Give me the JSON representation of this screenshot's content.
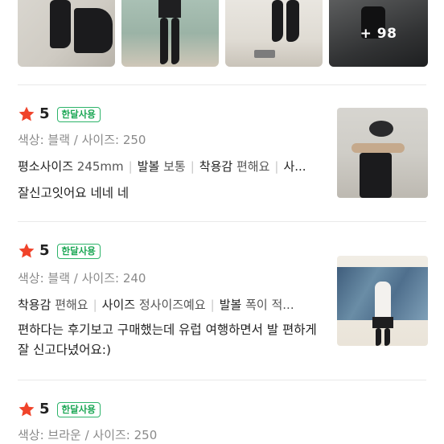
{
  "gallery": {
    "more_count": "+ 98"
  },
  "reviews": [
    {
      "rating": "5",
      "badge": "한달사용",
      "options": "색상: 블랙 / 사이즈: 250",
      "details": [
        {
          "key": "평소사이즈",
          "value": "245mm"
        },
        {
          "key": "발볼",
          "value": "보통"
        },
        {
          "key": "착용감",
          "value": "편해요"
        },
        {
          "key": "사...",
          "value": ""
        }
      ],
      "text": "잘신고잇어요 네네 네"
    },
    {
      "rating": "5",
      "badge": "한달사용",
      "options": "색상: 블랙 / 사이즈: 240",
      "details": [
        {
          "key": "착용감",
          "value": "편해요"
        },
        {
          "key": "사이즈",
          "value": "정사이즈예요"
        },
        {
          "key": "발볼",
          "value": "폭이 적..."
        }
      ],
      "text": "편하다는 후기보고 구매했는데 유럽 여행하면서 발 편하게 잘 신고다녔어요:)"
    },
    {
      "rating": "5",
      "badge": "한달사용",
      "options": "색상: 브라운 / 사이즈: 250"
    }
  ],
  "colors": {
    "star": "#f0432a",
    "badge": "#19a653"
  }
}
